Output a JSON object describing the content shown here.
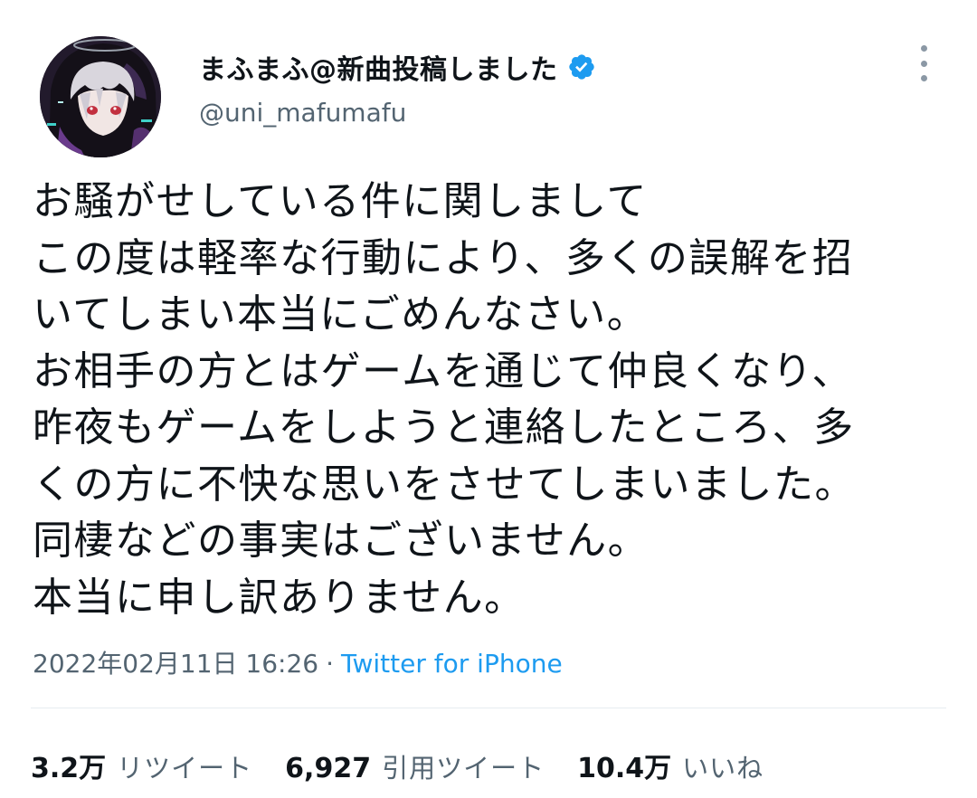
{
  "author": {
    "display_name": "まふまふ@新曲投稿しました",
    "handle": "@uni_mafumafu",
    "verified": true,
    "avatar_icon": "avatar-illustration"
  },
  "tweet": {
    "lines": [
      "お騒がせしている件に関しまして",
      "この度は軽率な行動により、多くの誤解を招",
      "いてしまい本当にごめんなさい。",
      "お相手の方とはゲームを通じて仲良くなり、",
      "昨夜もゲームをしようと連絡したところ、多",
      "くの方に不快な思いをさせてしまいました。",
      "同棲などの事実はございません。",
      "本当に申し訳ありません。"
    ]
  },
  "meta": {
    "timestamp": "2022年02月11日 16:26",
    "separator": "·",
    "source": "Twitter for iPhone"
  },
  "stats": {
    "retweets": {
      "count": "3.2万",
      "label": "リツイート"
    },
    "quotes": {
      "count": "6,927",
      "label": "引用ツイート"
    },
    "likes": {
      "count": "10.4万",
      "label": "いいね"
    }
  },
  "colors": {
    "text": "#0f1419",
    "secondary": "#536471",
    "accent": "#1d9bf0",
    "divider": "#e6ecf0"
  }
}
